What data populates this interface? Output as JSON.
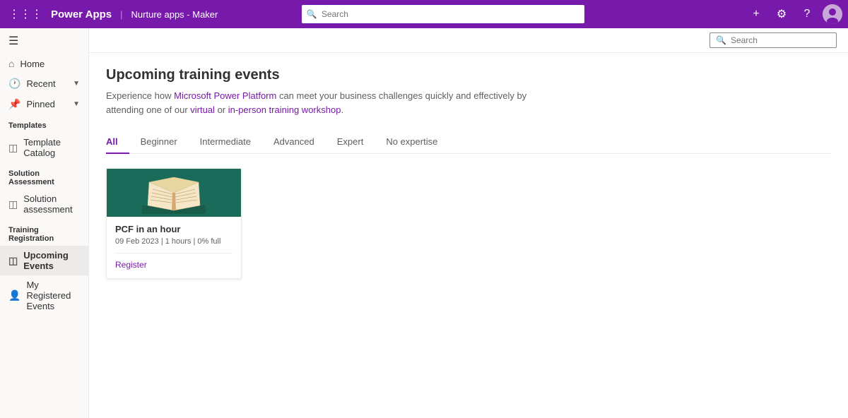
{
  "topNav": {
    "brand": "Power Apps",
    "divider": "|",
    "appName": "Nurture apps - Maker",
    "searchPlaceholder": "Search"
  },
  "sidebar": {
    "toggleIcon": "≡",
    "navItems": [
      {
        "id": "home",
        "label": "Home",
        "icon": "⌂",
        "hasChevron": false
      },
      {
        "id": "recent",
        "label": "Recent",
        "icon": "⏱",
        "hasChevron": true
      },
      {
        "id": "pinned",
        "label": "Pinned",
        "icon": "📌",
        "hasChevron": true
      }
    ],
    "sections": [
      {
        "id": "templates",
        "header": "Templates",
        "items": [
          {
            "id": "template-catalog",
            "label": "Template Catalog",
            "icon": "⊞"
          }
        ]
      },
      {
        "id": "solution-assessment",
        "header": "Solution Assessment",
        "items": [
          {
            "id": "solution-assessment",
            "label": "Solution assessment",
            "icon": "⊞"
          }
        ]
      },
      {
        "id": "training-registration",
        "header": "Training Registration",
        "items": [
          {
            "id": "upcoming-events",
            "label": "Upcoming Events",
            "icon": "⊞",
            "active": true
          },
          {
            "id": "my-registered-events",
            "label": "My Registered Events",
            "icon": "👤"
          }
        ]
      }
    ]
  },
  "secondaryToolbar": {
    "searchPlaceholder": "Search"
  },
  "page": {
    "title": "Upcoming training events",
    "description": {
      "text": "Experience how Microsoft Power Platform can meet your business challenges quickly and effectively by attending one of our virtual or in-person training workshop.",
      "links": [
        {
          "text": "Microsoft Power Platform",
          "href": "#"
        },
        {
          "text": "virtual",
          "href": "#"
        },
        {
          "text": "in-person training workshop",
          "href": "#"
        }
      ]
    }
  },
  "tabs": [
    {
      "id": "all",
      "label": "All",
      "active": true
    },
    {
      "id": "beginner",
      "label": "Beginner"
    },
    {
      "id": "intermediate",
      "label": "Intermediate"
    },
    {
      "id": "advanced",
      "label": "Advanced"
    },
    {
      "id": "expert",
      "label": "Expert"
    },
    {
      "id": "no-expertise",
      "label": "No expertise"
    }
  ],
  "events": [
    {
      "id": "pcf-in-an-hour",
      "title": "PCF in an hour",
      "date": "09 Feb 2023",
      "duration": "1 hours",
      "capacity": "0% full",
      "meta": "09 Feb 2023 | 1 hours | 0% full",
      "registerLabel": "Register"
    }
  ]
}
